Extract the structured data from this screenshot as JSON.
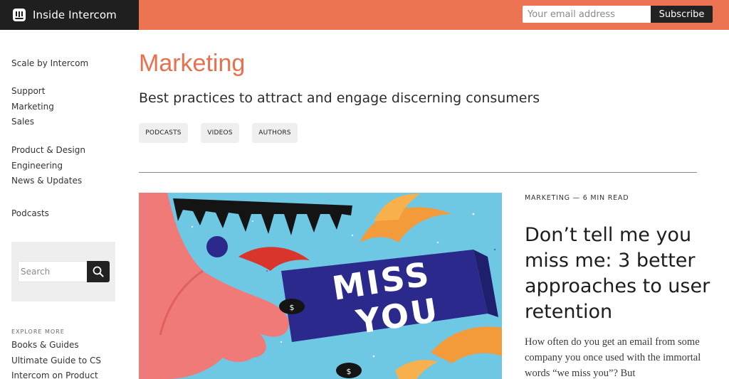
{
  "header": {
    "brand": "Inside Intercom",
    "email_placeholder": "Your email address",
    "subscribe_label": "Subscribe"
  },
  "sidebar": {
    "links": [
      "Scale by Intercom",
      "Support",
      "Marketing",
      "Sales",
      "Product & Design",
      "Engineering",
      "News & Updates",
      "Podcasts"
    ],
    "search_placeholder": "Search",
    "explore_label": "EXPLORE MORE",
    "explore_links": [
      "Books & Guides",
      "Ultimate Guide to CS",
      "Intercom on Product"
    ]
  },
  "main": {
    "title": "Marketing",
    "subtitle": "Best practices to attract and engage discerning consumers",
    "tags": [
      "PODCASTS",
      "VIDEOS",
      "AUTHORS"
    ]
  },
  "article": {
    "meta": "MARKETING — 6 MIN READ",
    "title": "Don’t tell me you miss me: 3 better approaches to user retention",
    "excerpt": "How often do you get an email from some company you once used with the immortal words “we miss you”? But",
    "image_text": "MISS YOU"
  },
  "colors": {
    "accent": "#ec7453",
    "title_orange": "#e8704d",
    "dark": "#1f1f1f",
    "hero_sky": "#6ec8e4",
    "hero_navy": "#2b2a8c",
    "hero_pink": "#f07a78",
    "hero_orange": "#f39a3a"
  },
  "icons": {
    "brand": "intercom-logo-icon",
    "search": "search-icon"
  }
}
